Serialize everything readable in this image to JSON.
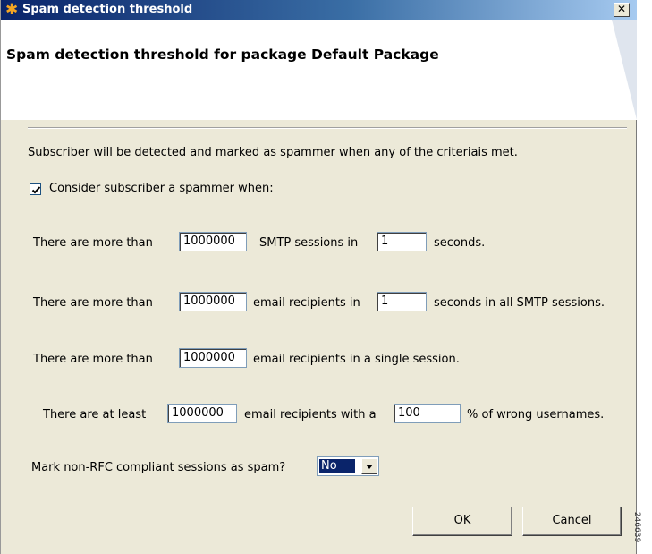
{
  "window": {
    "title": "Spam detection threshold",
    "header_title": "Spam detection threshold for package Default Package"
  },
  "description": "Subscriber will be detected and marked as spammer when any of the criteriais met.",
  "consider_checkbox": {
    "checked": true,
    "label": "Consider subscriber a spammer when:"
  },
  "rows": [
    {
      "prefix": "There are more than",
      "value1": "1000000",
      "middle": "SMTP sessions in",
      "value2": "1",
      "suffix": "seconds."
    },
    {
      "prefix": "There are more than",
      "value1": "1000000",
      "middle": "email recipients in",
      "value2": "1",
      "suffix": "seconds in all SMTP sessions."
    },
    {
      "prefix": "There are more than",
      "value1": "1000000",
      "middle": "email recipients in a single session."
    },
    {
      "prefix": "There are at least",
      "value1": "1000000",
      "middle": "email recipients with a",
      "value2": "100",
      "suffix": "% of wrong usernames."
    }
  ],
  "non_rfc": {
    "label": "Mark non-RFC compliant sessions as spam?",
    "selected": "No"
  },
  "buttons": {
    "ok": "OK",
    "cancel": "Cancel"
  },
  "side_id": "246639"
}
